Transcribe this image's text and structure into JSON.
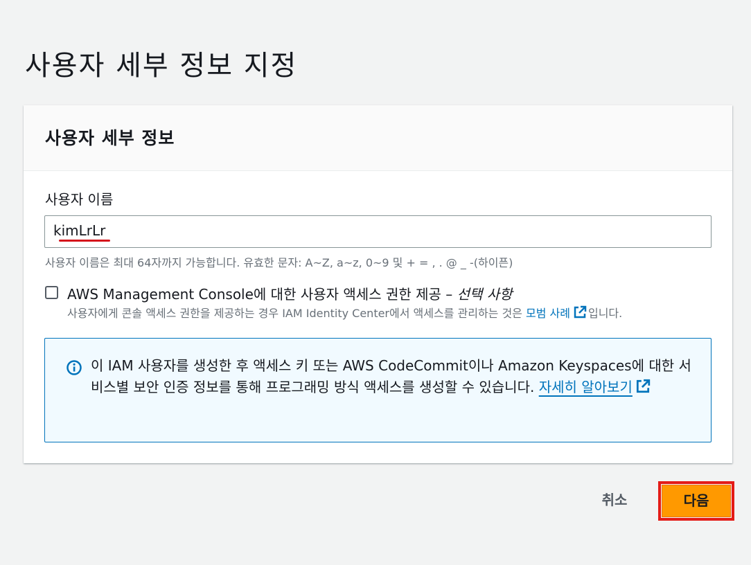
{
  "page": {
    "title": "사용자 세부 정보 지정"
  },
  "card": {
    "title": "사용자 세부 정보",
    "username": {
      "label": "사용자 이름",
      "value": "kimLrLr",
      "hint": "사용자 이름은 최대 64자까지 가능합니다. 유효한 문자: A~Z, a~z, 0~9 및 + = , . @ _ -(하이픈)"
    },
    "console_access": {
      "checked": false,
      "label": "AWS Management Console에 대한 사용자 액세스 권한 제공 – ",
      "label_optional": "선택 사항",
      "desc_before": "사용자에게 콘솔 액세스 권한을 제공하는 경우 IAM Identity Center에서 액세스를 관리하는 것은 ",
      "desc_link": "모범 사례",
      "desc_after": "입니다."
    },
    "info": {
      "icon": "info-icon",
      "text": "이 IAM 사용자를 생성한 후 액세스 키 또는 AWS CodeCommit이나 Amazon Keyspaces에 대한 서비스별 보안 인증 정보를 통해 프로그래밍 방식 액세스를 생성할 수 있습니다. ",
      "link": "자세히 알아보기"
    }
  },
  "actions": {
    "cancel_label": "취소",
    "next_label": "다음"
  },
  "colors": {
    "background": "#f2f3f3",
    "link": "#0073bb",
    "primary_button": "#ff9900",
    "highlight_outline": "#e41b17",
    "info_bg": "#f1faff"
  }
}
